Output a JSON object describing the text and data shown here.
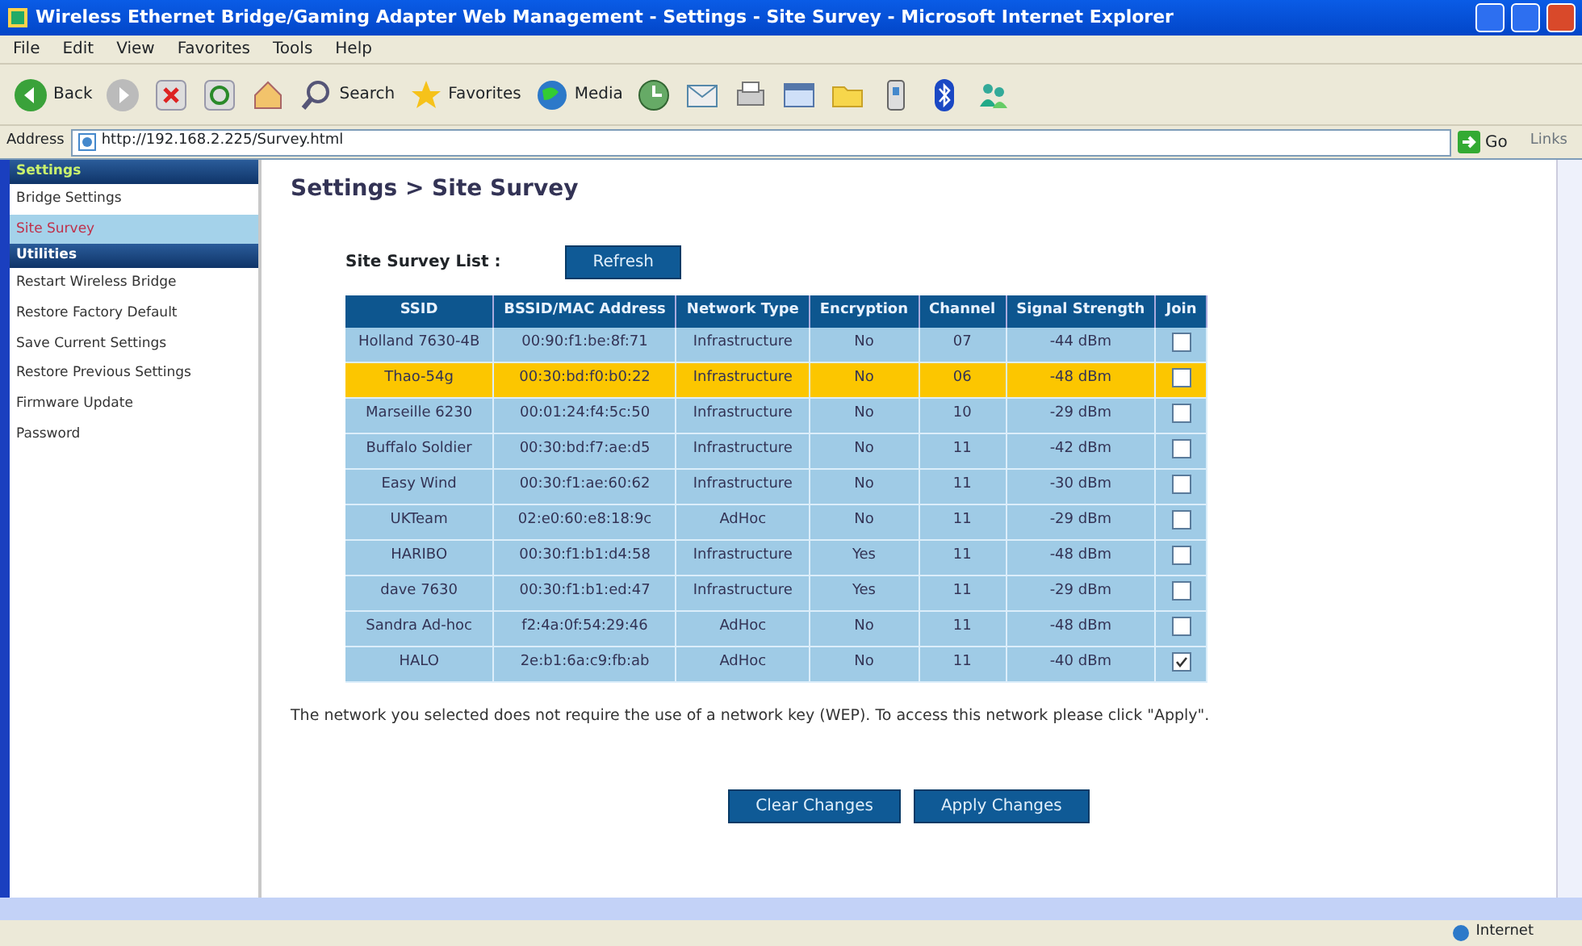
{
  "window": {
    "title": "Wireless Ethernet Bridge/Gaming Adapter Web Management - Settings - Site Survey - Microsoft Internet Explorer"
  },
  "menu": [
    "File",
    "Edit",
    "View",
    "Favorites",
    "Tools",
    "Help"
  ],
  "toolbar": [
    {
      "kind": "back",
      "label": "Back"
    },
    {
      "kind": "forward"
    },
    {
      "kind": "stop"
    },
    {
      "kind": "refresh"
    },
    {
      "kind": "home"
    },
    {
      "kind": "search",
      "label": "Search"
    },
    {
      "kind": "favorites",
      "label": "Favorites"
    },
    {
      "kind": "media",
      "label": "Media"
    },
    {
      "kind": "history"
    },
    {
      "kind": "mail"
    },
    {
      "kind": "print"
    },
    {
      "kind": "edit"
    },
    {
      "kind": "folder"
    },
    {
      "kind": "device"
    },
    {
      "kind": "bluetooth"
    },
    {
      "kind": "messenger"
    }
  ],
  "address_bar": {
    "label": "Address",
    "url": "http://192.168.2.225/Survey.html",
    "go": "Go",
    "links": "Links"
  },
  "sidebar": [
    {
      "title": "Settings",
      "items": [
        {
          "label": "Bridge Settings",
          "selected": false
        },
        {
          "label": "Site Survey",
          "selected": true
        }
      ]
    },
    {
      "title": "Utilities",
      "items": [
        {
          "label": "Restart Wireless Bridge",
          "selected": false
        },
        {
          "label": "Restore Factory Default",
          "selected": false
        },
        {
          "label": "Save Current Settings",
          "selected": false
        },
        {
          "label": "Restore Previous Settings",
          "selected": false
        },
        {
          "label": "Firmware Update",
          "selected": false
        },
        {
          "label": "Password",
          "selected": false
        }
      ]
    }
  ],
  "page_title": "Settings > Site Survey",
  "list_label": "Site Survey List :",
  "refresh_button": "Refresh",
  "table": {
    "columns": [
      "SSID",
      "BSSID/MAC Address",
      "Network Type",
      "Encryption",
      "Channel",
      "Signal Strength",
      "Join"
    ],
    "rows": [
      {
        "cells": [
          "Holland 7630-4B",
          "00:90:f1:be:8f:71",
          "Infrastructure",
          "No",
          "07",
          "-44 dBm"
        ],
        "selected": false,
        "join": false
      },
      {
        "cells": [
          "Thao-54g",
          "00:30:bd:f0:b0:22",
          "Infrastructure",
          "No",
          "06",
          "-48 dBm"
        ],
        "selected": true,
        "join": false
      },
      {
        "cells": [
          "Marseille 6230",
          "00:01:24:f4:5c:50",
          "Infrastructure",
          "No",
          "10",
          "-29 dBm"
        ],
        "selected": false,
        "join": false
      },
      {
        "cells": [
          "Buffalo Soldier",
          "00:30:bd:f7:ae:d5",
          "Infrastructure",
          "No",
          "11",
          "-42 dBm"
        ],
        "selected": false,
        "join": false
      },
      {
        "cells": [
          "Easy Wind",
          "00:30:f1:ae:60:62",
          "Infrastructure",
          "No",
          "11",
          "-30 dBm"
        ],
        "selected": false,
        "join": false
      },
      {
        "cells": [
          "UKTeam",
          "02:e0:60:e8:18:9c",
          "AdHoc",
          "No",
          "11",
          "-29 dBm"
        ],
        "selected": false,
        "join": false
      },
      {
        "cells": [
          "HARIBO",
          "00:30:f1:b1:d4:58",
          "Infrastructure",
          "Yes",
          "11",
          "-48 dBm"
        ],
        "selected": false,
        "join": false
      },
      {
        "cells": [
          "dave 7630",
          "00:30:f1:b1:ed:47",
          "Infrastructure",
          "Yes",
          "11",
          "-29 dBm"
        ],
        "selected": false,
        "join": false
      },
      {
        "cells": [
          "Sandra Ad-hoc",
          "f2:4a:0f:54:29:46",
          "AdHoc",
          "No",
          "11",
          "-48 dBm"
        ],
        "selected": false,
        "join": false
      },
      {
        "cells": [
          "HALO",
          "2e:b1:6a:c9:fb:ab",
          "AdHoc",
          "No",
          "11",
          "-40 dBm"
        ],
        "selected": false,
        "join": true
      }
    ]
  },
  "note": "The network you selected does not require the use of a network key (WEP). To access this network please click \"Apply\".",
  "buttons": [
    "Clear Changes",
    "Apply Changes"
  ],
  "status_bar": {
    "zone": "Internet"
  }
}
